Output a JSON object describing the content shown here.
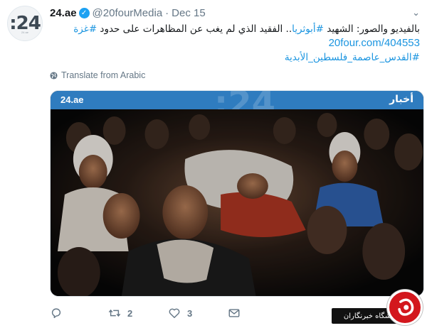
{
  "account": {
    "avatar_text": ":24",
    "avatar_subtext": "24 ae",
    "display_name": "24.ae",
    "handle": "@20fourMedia",
    "separator": "·",
    "date": "Dec 15"
  },
  "tweet": {
    "line1_text": "بالفيديو والصور: الشهيد ",
    "line1_hashtag1": "#أبوثريا",
    "line1_text2": ".. الفقيد الذي لم يغب عن المظاهرات على حدود ",
    "line1_hashtag2": "#غزة",
    "link": "20four.com/404553",
    "hashtag3": "#القدس_عاصمة_فلسطين_الأبدية"
  },
  "translate_label": "Translate from Arabic",
  "media": {
    "logo": "24.ae",
    "big_mark": ":24",
    "section": "أخبار"
  },
  "actions": {
    "reply_count": "",
    "retweet_count": "2",
    "like_count": "3"
  },
  "watermark": {
    "label": "باشگاه خبرنگاران"
  },
  "colors": {
    "link": "#1b95e0",
    "verified": "#1da1f2",
    "muted": "#657786",
    "media_bar": "#2f7cbf",
    "watermark_red": "#d3171d"
  },
  "icons": [
    "globe-icon",
    "verified-icon",
    "caret-down-icon",
    "reply-icon",
    "retweet-icon",
    "like-icon",
    "dm-icon"
  ]
}
